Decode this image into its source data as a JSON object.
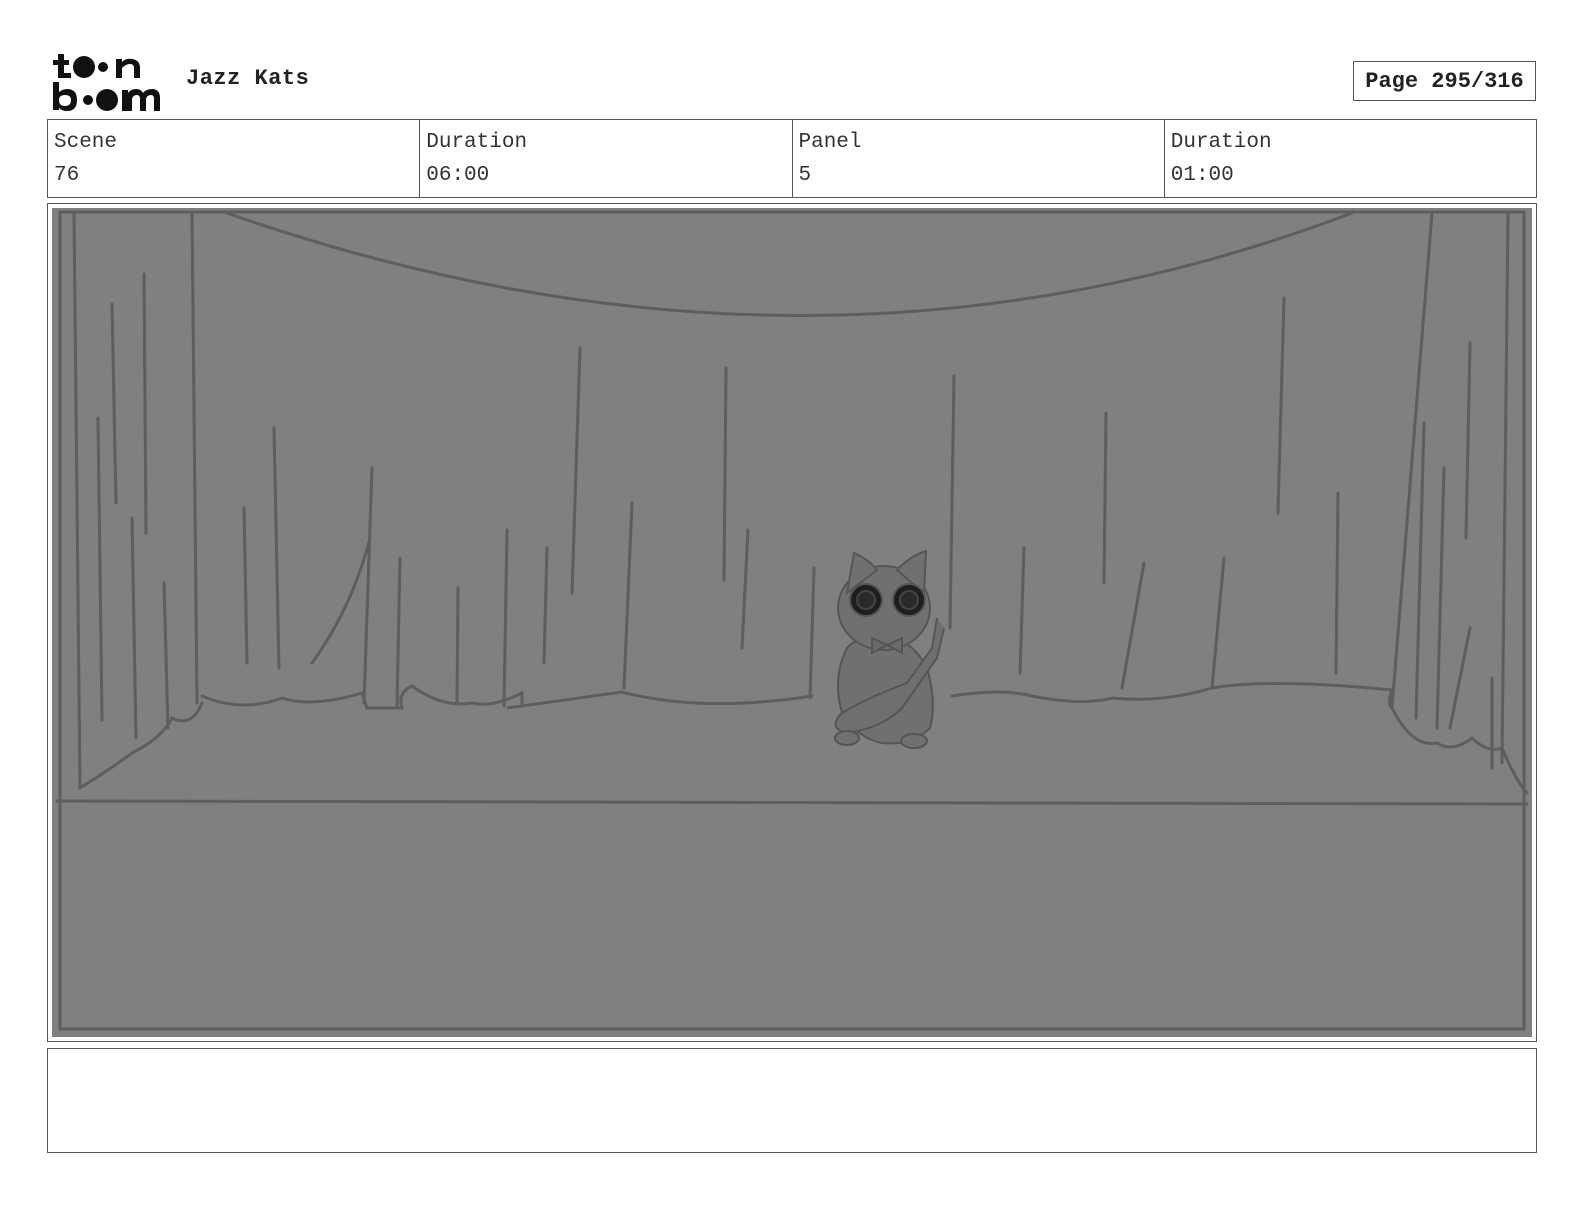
{
  "header": {
    "logo_text": "toon boom",
    "project_title": "Jazz Kats",
    "page_label": "Page 295/316"
  },
  "info": {
    "scene_label": "Scene",
    "scene_value": "76",
    "scene_duration_label": "Duration",
    "scene_duration_value": "06:00",
    "panel_label": "Panel",
    "panel_value": "5",
    "panel_duration_label": "Duration",
    "panel_duration_value": "01:00"
  },
  "caption": {
    "text": ""
  },
  "colors": {
    "panel_fill": "#808080",
    "sketch_line": "#5e5e5e",
    "border": "#555555"
  }
}
